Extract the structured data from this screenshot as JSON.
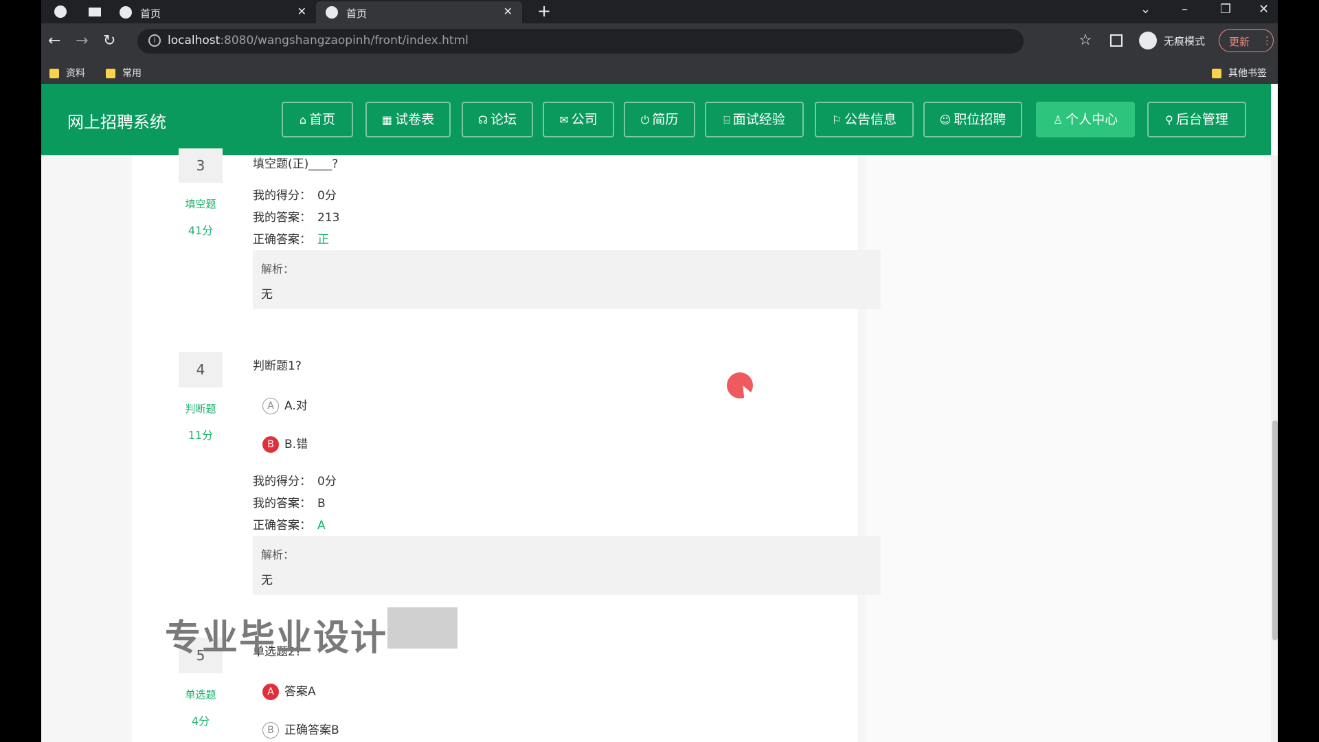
{
  "browser": {
    "tabs": [
      {
        "title": "首页",
        "active": false
      },
      {
        "title": "首页",
        "active": true
      }
    ],
    "url_host": "localhost",
    "url_path": ":8080/wangshangzaopinh/front/index.html",
    "incognito_label": "无痕模式",
    "update_label": "更新",
    "bookmarks": [
      "资料",
      "常用"
    ],
    "other_bookmarks": "其他书签"
  },
  "site": {
    "title": "网上招聘系统",
    "nav": [
      {
        "icon": "⌂",
        "label": "首页"
      },
      {
        "icon": "▦",
        "label": "试卷表"
      },
      {
        "icon": "☊",
        "label": "论坛"
      },
      {
        "icon": "✉",
        "label": "公司"
      },
      {
        "icon": "⏻",
        "label": "简历"
      },
      {
        "icon": "⌸",
        "label": "面试经验"
      },
      {
        "icon": "⚐",
        "label": "公告信息"
      },
      {
        "icon": "☺",
        "label": "职位招聘"
      },
      {
        "icon": "♙",
        "label": "个人中心"
      },
      {
        "icon": "⚲",
        "label": "后台管理"
      }
    ]
  },
  "labels": {
    "my_score": "我的得分：",
    "my_answer": "我的答案：",
    "correct_answer": "正确答案：",
    "analysis": "解析："
  },
  "questions": [
    {
      "number": "3",
      "type": "填空题",
      "points": "41分",
      "title": "填空题(正)____?",
      "my_score": "0分",
      "my_answer": "213",
      "correct_answer": "正",
      "analysis": "无"
    },
    {
      "number": "4",
      "type": "判断题",
      "points": "11分",
      "title": "判断题1?",
      "options": [
        {
          "letter": "A",
          "text": "A.对",
          "selected": false
        },
        {
          "letter": "B",
          "text": "B.错",
          "selected": true
        }
      ],
      "my_score": "0分",
      "my_answer": "B",
      "correct_answer": "A",
      "analysis": "无"
    },
    {
      "number": "5",
      "type": "单选题",
      "points": "4分",
      "title": "单选题2?",
      "options": [
        {
          "letter": "A",
          "text": "答案A",
          "selected": true
        },
        {
          "letter": "B",
          "text": "正确答案B",
          "selected": false
        }
      ]
    }
  ],
  "overlay": {
    "watermark": "专业毕业设计"
  }
}
